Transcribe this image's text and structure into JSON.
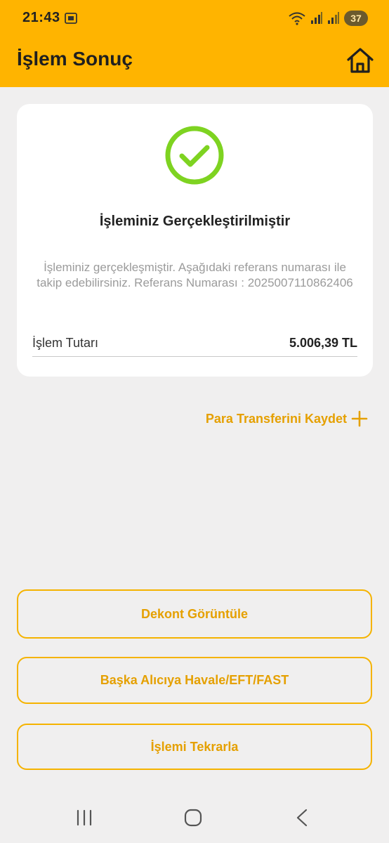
{
  "status_bar": {
    "time": "21:43",
    "battery": "37",
    "icons": [
      "screenshot-icon",
      "wifi-icon",
      "signal-icon",
      "signal-icon-2"
    ]
  },
  "header": {
    "title": "İşlem Sonuç",
    "home_icon": "home-icon"
  },
  "result": {
    "icon": "check-circle-icon",
    "title": "İşleminiz Gerçekleştirilmiştir",
    "description": "İşleminiz gerçekleşmiştir. Aşağıdaki referans numarası ile takip edebilirsiniz. Referans Numarası : 2025007110862406",
    "amount_label": "İşlem Tutarı",
    "amount_value": "5.006,39 TL"
  },
  "save_transfer": {
    "label": "Para Transferini Kaydet",
    "icon": "plus-icon"
  },
  "actions": {
    "receipt": "Dekont Görüntüle",
    "another_recipient": "Başka Alıcıya Havale/EFT/FAST",
    "repeat": "İşlemi Tekrarla"
  },
  "nav": {
    "icons": [
      "recent-apps-icon",
      "home-icon",
      "back-icon"
    ]
  },
  "colors": {
    "brand": "#ffb400",
    "accent": "#e5a000",
    "success": "#7ed321"
  }
}
